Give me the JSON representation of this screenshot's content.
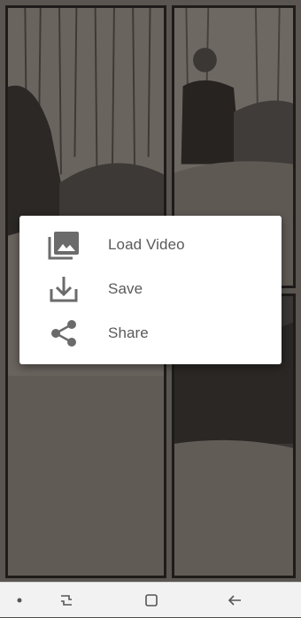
{
  "menu": {
    "items": [
      {
        "label": "Load Video",
        "icon": "image-library-icon"
      },
      {
        "label": "Save",
        "icon": "download-tray-icon"
      },
      {
        "label": "Share",
        "icon": "share-icon"
      }
    ]
  },
  "navbar": {
    "buttons": [
      "dot-indicator",
      "recent-apps",
      "home",
      "back"
    ]
  },
  "colors": {
    "scrim": "#5a5550",
    "menu_background": "#ffffff",
    "menu_text": "#5a5a5a",
    "icon": "#6b6b6b",
    "navbar": "#f2f2f2"
  }
}
